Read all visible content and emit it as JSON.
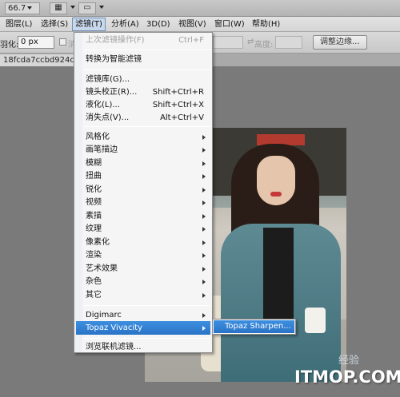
{
  "appbar": {
    "zoom": "66.7",
    "arrange_icon": "arrange-documents-icon",
    "screen_mode_icon": "screen-mode-icon"
  },
  "menubar": {
    "items": [
      {
        "label": "图层(L)"
      },
      {
        "label": "选择(S)"
      },
      {
        "label": "滤镜(T)"
      },
      {
        "label": "分析(A)"
      },
      {
        "label": "3D(D)"
      },
      {
        "label": "视图(V)"
      },
      {
        "label": "窗口(W)"
      },
      {
        "label": "帮助(H)"
      }
    ],
    "active_index": 2
  },
  "options": {
    "feather_label": "羽化:",
    "feather_value": "0 px",
    "antialias_label": "消除",
    "height_label": "高度:",
    "refine_edge_label": "调整边缘..."
  },
  "doc_tab": {
    "filename": "18fcda7ccbd924c.jpg"
  },
  "menu": {
    "items": [
      {
        "label": "上次滤镜操作(F)",
        "shortcut": "Ctrl+F",
        "disabled": true
      },
      {
        "label": "转换为智能滤镜"
      },
      {
        "label": "滤镜库(G)..."
      },
      {
        "label": "镜头校正(R)...",
        "shortcut": "Shift+Ctrl+R"
      },
      {
        "label": "液化(L)...",
        "shortcut": "Shift+Ctrl+X"
      },
      {
        "label": "消失点(V)...",
        "shortcut": "Alt+Ctrl+V"
      },
      {
        "label": "风格化",
        "submenu": true
      },
      {
        "label": "画笔描边",
        "submenu": true
      },
      {
        "label": "模糊",
        "submenu": true
      },
      {
        "label": "扭曲",
        "submenu": true
      },
      {
        "label": "锐化",
        "submenu": true
      },
      {
        "label": "视频",
        "submenu": true
      },
      {
        "label": "素描",
        "submenu": true
      },
      {
        "label": "纹理",
        "submenu": true
      },
      {
        "label": "像素化",
        "submenu": true
      },
      {
        "label": "渲染",
        "submenu": true
      },
      {
        "label": "艺术效果",
        "submenu": true
      },
      {
        "label": "杂色",
        "submenu": true
      },
      {
        "label": "其它",
        "submenu": true
      },
      {
        "label": "Digimarc",
        "submenu": true
      },
      {
        "label": "Topaz Vivacity",
        "submenu": true,
        "highlighted": true
      },
      {
        "label": "浏览联机滤镜..."
      }
    ]
  },
  "submenu": {
    "item": "Topaz Sharpen..."
  },
  "watermark": {
    "main": "ITMOP.COM",
    "secondary": "经验"
  }
}
